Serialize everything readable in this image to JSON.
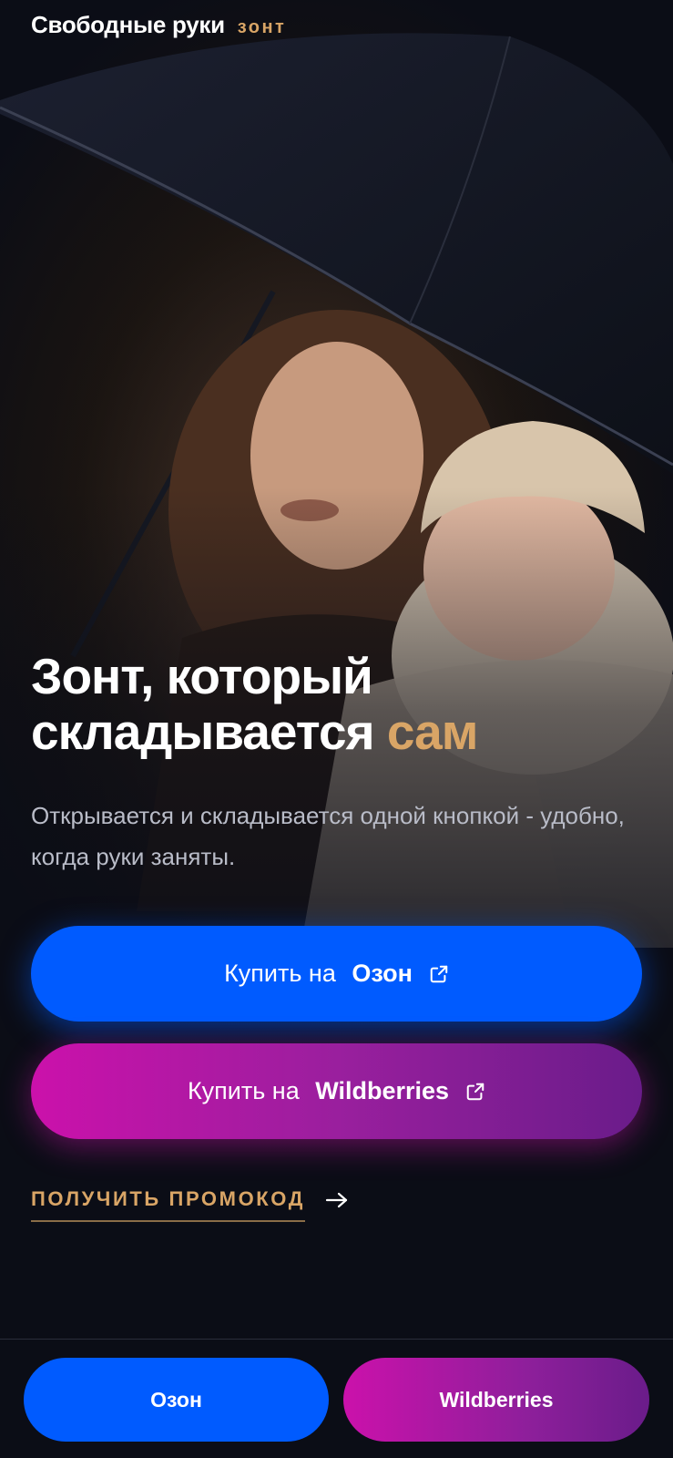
{
  "header": {
    "brand_name": "Свободные руки",
    "brand_tag": "зонт"
  },
  "hero": {
    "headline_line1": "Зонт, который",
    "headline_line2_main": "складывается ",
    "headline_line2_accent": "сам",
    "subtitle": "Открывается и складывается одной кнопкой - удобно, когда руки заняты."
  },
  "buttons": {
    "ozon_prefix": "Купить на ",
    "ozon_store": "Озон",
    "wb_prefix": "Купить на ",
    "wb_store": "Wildberries",
    "external_icon": "external-link-icon"
  },
  "promo": {
    "label": "ПОЛУЧИТЬ ПРОМОКОД",
    "icon": "arrow-right-icon"
  },
  "bottom_bar": {
    "ozon_label": "Озон",
    "wb_label": "Wildberries"
  },
  "colors": {
    "accent_gold": "#d9a566",
    "ozon_blue": "#005bff",
    "wb_magenta": "#cb11ab",
    "wb_purple": "#6a1c8a",
    "background": "#0b0d16"
  }
}
